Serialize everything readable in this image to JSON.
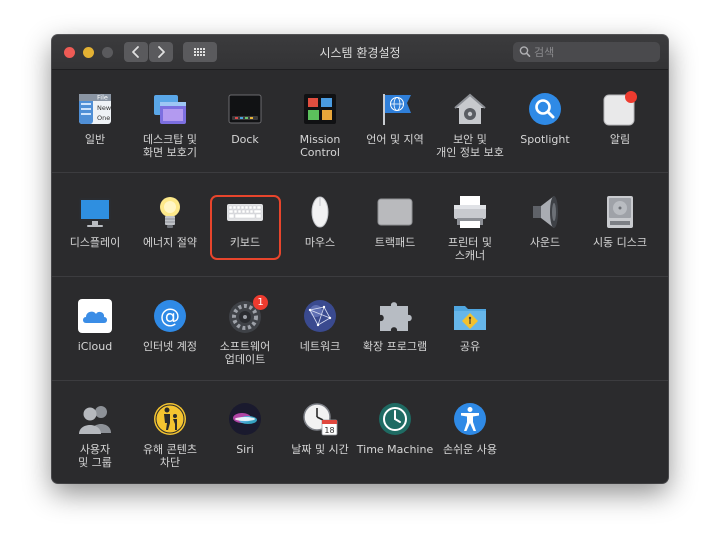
{
  "window": {
    "title": "시스템 환경설정",
    "search_placeholder": "검색",
    "accent": "#e8452c"
  },
  "rows": [
    [
      {
        "label": "일반",
        "icon": "general-icon",
        "interactable": true
      },
      {
        "label": "데스크탑 및\n화면 보호기",
        "icon": "desktop-screensaver-icon",
        "interactable": true
      },
      {
        "label": "Dock",
        "icon": "dock-icon",
        "interactable": true
      },
      {
        "label": "Mission\nControl",
        "icon": "mission-control-icon",
        "interactable": true
      },
      {
        "label": "언어 및 지역",
        "icon": "globe-flag-icon",
        "interactable": true
      },
      {
        "label": "보안 및\n개인 정보 보호",
        "icon": "house-lock-icon",
        "interactable": true
      },
      {
        "label": "Spotlight",
        "icon": "spotlight-magnifier-icon",
        "interactable": true
      },
      {
        "label": "알림",
        "icon": "notifications-icon",
        "interactable": true
      }
    ],
    [
      {
        "label": "디스플레이",
        "icon": "display-icon",
        "interactable": true
      },
      {
        "label": "에너지 절약",
        "icon": "lightbulb-icon",
        "interactable": true
      },
      {
        "label": "키보드",
        "icon": "keyboard-icon",
        "interactable": true
      },
      {
        "label": "마우스",
        "icon": "mouse-icon",
        "interactable": true
      },
      {
        "label": "트랙패드",
        "icon": "trackpad-icon",
        "interactable": true
      },
      {
        "label": "프린터 및\n스캐너",
        "icon": "printer-icon",
        "interactable": true
      },
      {
        "label": "사운드",
        "icon": "speaker-icon",
        "interactable": true
      },
      {
        "label": "시동 디스크",
        "icon": "hard-drive-icon",
        "interactable": true
      }
    ],
    [
      {
        "label": "iCloud",
        "icon": "icloud-icon",
        "interactable": true
      },
      {
        "label": "인터넷 계정",
        "icon": "at-sign-icon",
        "interactable": true
      },
      {
        "label": "소프트웨어\n업데이트",
        "icon": "software-update-gear-icon",
        "interactable": true,
        "badge": "1"
      },
      {
        "label": "네트워크",
        "icon": "network-globe-icon",
        "interactable": true
      },
      {
        "label": "확장 프로그램",
        "icon": "puzzle-piece-icon",
        "interactable": true
      },
      {
        "label": "공유",
        "icon": "sharing-folder-icon",
        "interactable": true
      }
    ],
    [
      {
        "label": "사용자\n및 그룹",
        "icon": "users-groups-icon",
        "interactable": true
      },
      {
        "label": "유해 콘텐츠\n차단",
        "icon": "parental-controls-icon",
        "interactable": true
      },
      {
        "label": "Siri",
        "icon": "siri-icon",
        "interactable": true
      },
      {
        "label": "날짜 및 시간",
        "icon": "clock-calendar-icon",
        "interactable": true
      },
      {
        "label": "Time Machine",
        "icon": "time-machine-icon",
        "interactable": true
      },
      {
        "label": "손쉬운 사용",
        "icon": "accessibility-icon",
        "interactable": true
      }
    ]
  ],
  "highlighted_item": "키보드",
  "general_icon_text": [
    "File",
    "New",
    "One"
  ],
  "calendar_day": "18"
}
